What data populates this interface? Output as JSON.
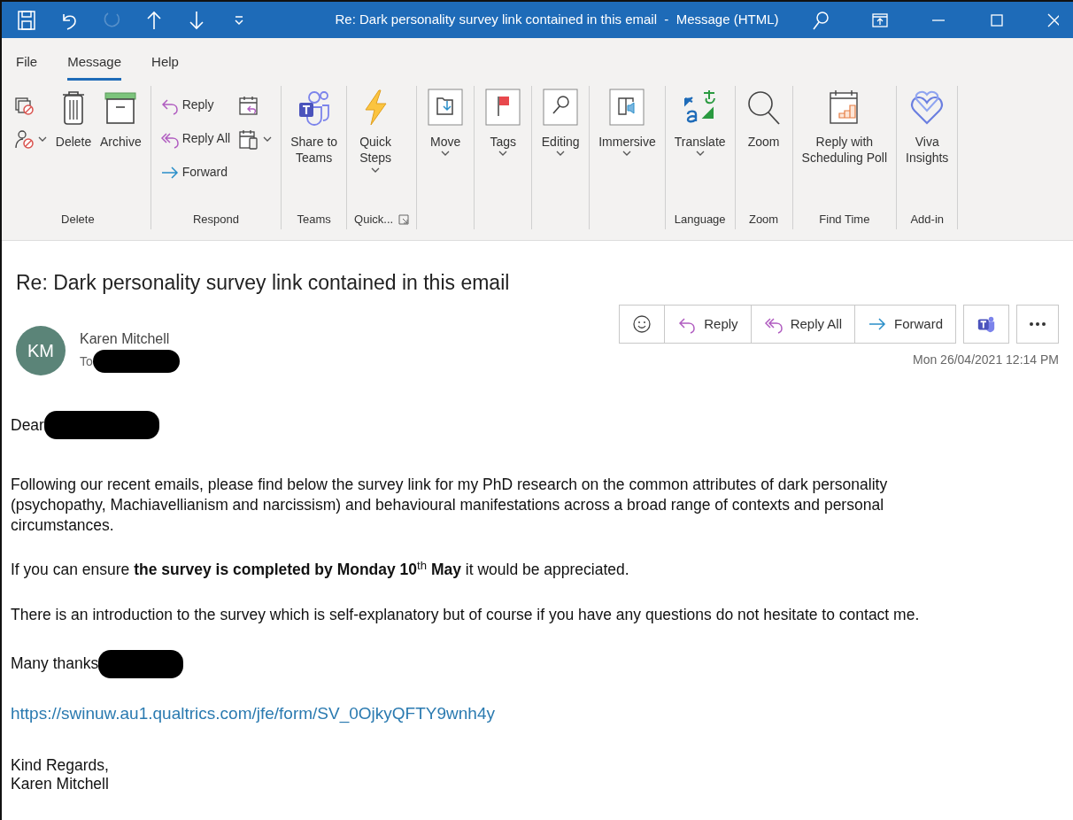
{
  "window": {
    "title": "Re: Dark personality survey link contained in this email  -  Message (HTML)",
    "quick_access": [
      {
        "kind": "save",
        "disabled": false
      },
      {
        "kind": "undo",
        "disabled": false
      },
      {
        "kind": "redo",
        "disabled": true
      },
      {
        "kind": "up",
        "disabled": false
      },
      {
        "kind": "down",
        "disabled": false
      },
      {
        "kind": "customize",
        "disabled": false
      }
    ]
  },
  "menu_tabs": [
    {
      "label": "File",
      "selected": false
    },
    {
      "label": "Message",
      "selected": true
    },
    {
      "label": "Help",
      "selected": false
    }
  ],
  "ribbon": {
    "groups": [
      {
        "label": "Delete",
        "launcher": false,
        "items": [
          {
            "stack": [
              {
                "kind": "ignore",
                "dropdown": false
              },
              {
                "kind": "block",
                "dropdown": true
              }
            ]
          },
          {
            "kind": "delete",
            "lines": [
              "Delete"
            ],
            "dropdown": false
          },
          {
            "kind": "archive",
            "lines": [
              "Archive"
            ],
            "dropdown": false
          }
        ]
      },
      {
        "label": "Respond",
        "launcher": false,
        "items": [
          {
            "stack": [
              {
                "kind": "reply",
                "label": "Reply",
                "dropdown": false
              },
              {
                "kind": "replyall",
                "label": "Reply All",
                "dropdown": false
              },
              {
                "kind": "forward",
                "label": "Forward",
                "dropdown": false
              }
            ]
          },
          {
            "stack": [
              {
                "kind": "meeting",
                "dropdown": false
              },
              {
                "kind": "more",
                "dropdown": true
              }
            ]
          }
        ]
      },
      {
        "label": "Teams",
        "launcher": false,
        "items": [
          {
            "kind": "teams",
            "lines": [
              "Share to",
              "Teams"
            ],
            "dropdown": false
          }
        ]
      },
      {
        "label": "Quick...",
        "launcher": true,
        "items": [
          {
            "kind": "bolt",
            "lines": [
              "Quick",
              "Steps"
            ],
            "dropdown": true
          }
        ]
      },
      {
        "launcher": false,
        "items": [
          {
            "kind": "move",
            "lines": [
              "Move"
            ],
            "dropdown": true
          }
        ]
      },
      {
        "launcher": false,
        "items": [
          {
            "kind": "tags",
            "lines": [
              "Tags"
            ],
            "dropdown": true
          }
        ]
      },
      {
        "launcher": false,
        "items": [
          {
            "kind": "editing",
            "lines": [
              "Editing"
            ],
            "dropdown": true
          }
        ]
      },
      {
        "launcher": false,
        "items": [
          {
            "kind": "immersive",
            "lines": [
              "Immersive"
            ],
            "dropdown": true
          }
        ]
      },
      {
        "label": "Language",
        "launcher": false,
        "items": [
          {
            "kind": "translate",
            "lines": [
              "Translate"
            ],
            "dropdown": true
          }
        ]
      },
      {
        "label": "Zoom",
        "launcher": false,
        "items": [
          {
            "kind": "zoom",
            "lines": [
              "Zoom"
            ],
            "dropdown": false
          }
        ]
      },
      {
        "label": "Find Time",
        "launcher": false,
        "items": [
          {
            "kind": "poll",
            "lines": [
              "Reply with",
              "Scheduling Poll"
            ],
            "dropdown": false
          }
        ]
      },
      {
        "label": "Add-in",
        "launcher": false,
        "items": [
          {
            "kind": "viva",
            "lines": [
              "Viva",
              "Insights"
            ],
            "dropdown": false
          }
        ]
      }
    ]
  },
  "message": {
    "subject": "Re: Dark personality survey link contained in this email",
    "sender": {
      "initials": "KM",
      "name": "Karen Mitchell",
      "to_label": "To"
    },
    "actions": [
      {
        "kind": "emoji"
      },
      {
        "kind": "reply",
        "label": "Reply"
      },
      {
        "kind": "replyall",
        "label": "Reply All"
      },
      {
        "kind": "forward",
        "label": "Forward"
      },
      {
        "kind": "teams"
      },
      {
        "kind": "more"
      }
    ],
    "date": "Mon 26/04/2021 12:14 PM",
    "body": [
      {
        "kind": "greeting",
        "text": "Dear"
      },
      {
        "kind": "paragraph",
        "text": "Following our recent emails, please find below the survey link for my PhD research on the common attributes of dark personality (psychopathy, Machiavellianism and narcissism) and behavioural manifestations across a broad range of contexts and personal circumstances."
      },
      {
        "kind": "paragraph",
        "text": "If you can ensure **the survey is completed by Monday 10**$^{th}$ **May** it would be appreciated."
      },
      {
        "kind": "paragraph",
        "text": "There is an introduction to the survey which is self-explanatory but of course if you have any questions do not hesitate to contact me."
      },
      {
        "kind": "thanks",
        "text": "Many thanks"
      },
      {
        "kind": "link",
        "text": "https://swinuw.au1.qualtrics.com/jfe/form/SV_0OjkyQFTY9wnh4y"
      },
      {
        "kind": "signoff",
        "lines": [
          "Kind Regards,",
          "Karen Mitchell"
        ]
      }
    ]
  }
}
